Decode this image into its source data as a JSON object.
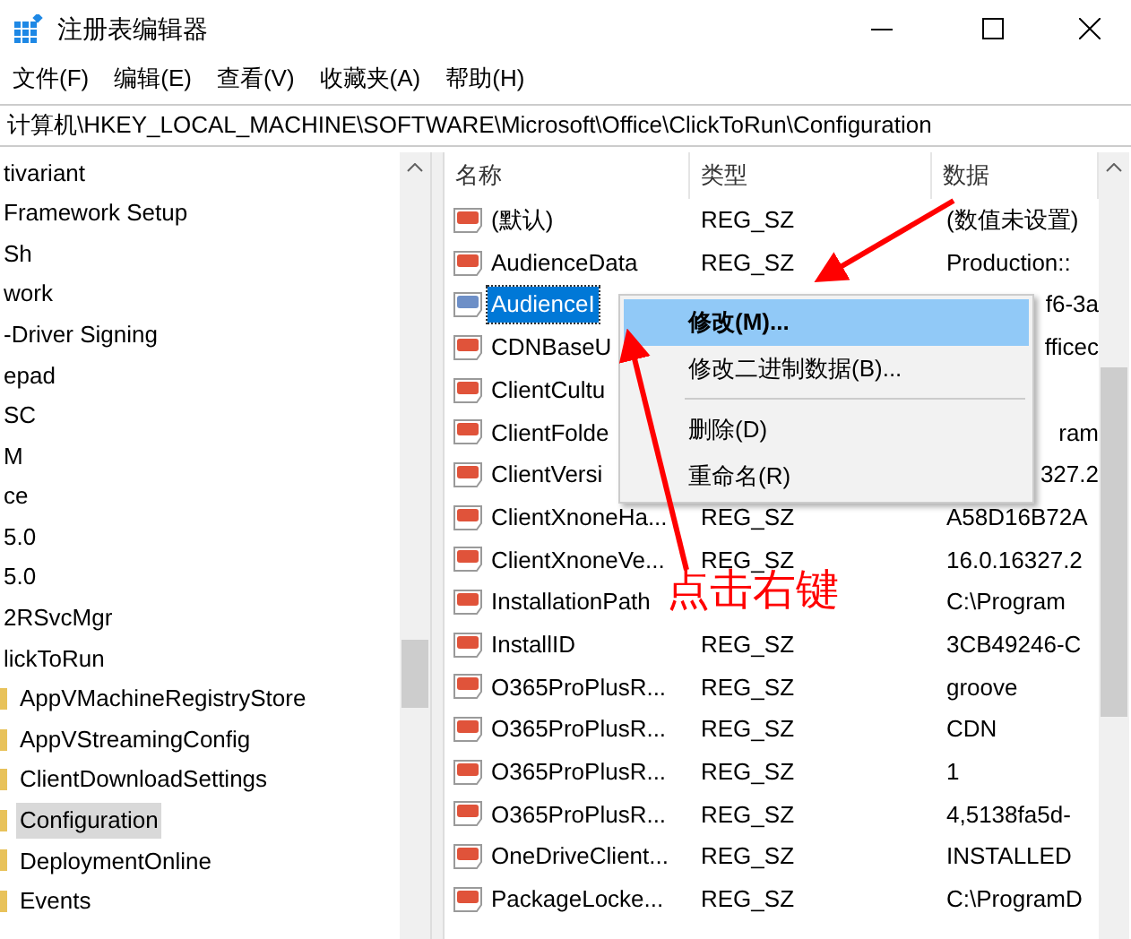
{
  "window": {
    "title": "注册表编辑器"
  },
  "menu_bar": [
    "文件(F)",
    "编辑(E)",
    "查看(V)",
    "收藏夹(A)",
    "帮助(H)"
  ],
  "address": "计算机\\HKEY_LOCAL_MACHINE\\SOFTWARE\\Microsoft\\Office\\ClickToRun\\Configuration",
  "tree": [
    {
      "label": "tivariant",
      "selected": false
    },
    {
      "label": "Framework Setup",
      "selected": false
    },
    {
      "label": "Sh",
      "selected": false
    },
    {
      "label": "work",
      "selected": false
    },
    {
      "label": "-Driver Signing",
      "selected": false
    },
    {
      "label": "epad",
      "selected": false
    },
    {
      "label": "SC",
      "selected": false
    },
    {
      "label": "M",
      "selected": false
    },
    {
      "label": "ce",
      "selected": false
    },
    {
      "label": "5.0",
      "selected": false
    },
    {
      "label": "5.0",
      "selected": false
    },
    {
      "label": "2RSvcMgr",
      "selected": false
    },
    {
      "label": "lickToRun",
      "selected": false,
      "children": [
        {
          "label": "AppVMachineRegistryStore",
          "selected": false
        },
        {
          "label": "AppVStreamingConfig",
          "selected": false
        },
        {
          "label": "ClientDownloadSettings",
          "selected": false
        },
        {
          "label": "Configuration",
          "selected": true
        },
        {
          "label": "DeploymentOnline",
          "selected": false
        },
        {
          "label": "Events",
          "selected": false
        }
      ]
    }
  ],
  "values": {
    "columns": [
      "名称",
      "类型",
      "数据"
    ],
    "rows": [
      {
        "name": "(默认)",
        "type": "REG_SZ",
        "data": "(数值未设置)",
        "selected": false,
        "covered": false
      },
      {
        "name": "AudienceData",
        "type": "REG_SZ",
        "data": "Production::",
        "selected": false,
        "covered": false
      },
      {
        "name": "AudienceI",
        "data": "f6-3a",
        "selected": true,
        "covered": true
      },
      {
        "name": "CDNBaseU",
        "data": "fficec",
        "selected": false,
        "covered": true
      },
      {
        "name": "ClientCultu",
        "selected": false
      },
      {
        "name": "ClientFolde",
        "data": "ram",
        "selected": false,
        "covered": true
      },
      {
        "name": "ClientVersi",
        "data": "327.2",
        "selected": false,
        "covered": true
      },
      {
        "name": "ClientXnoneHa...",
        "type": "REG_SZ",
        "data": "A58D16B72A",
        "selected": false,
        "covered": false
      },
      {
        "name": "ClientXnoneVe...",
        "type": "REG_SZ",
        "data": "16.0.16327.2",
        "selected": false,
        "covered": false
      },
      {
        "name": "InstallationPath",
        "data": "C:\\Program",
        "selected": false,
        "covered": false
      },
      {
        "name": "InstallID",
        "type": "REG_SZ",
        "data": "3CB49246-C",
        "selected": false,
        "covered": false
      },
      {
        "name": "O365ProPlusR...",
        "type": "REG_SZ",
        "data": "groove",
        "selected": false,
        "covered": false
      },
      {
        "name": "O365ProPlusR...",
        "type": "REG_SZ",
        "data": "CDN",
        "selected": false,
        "covered": false
      },
      {
        "name": "O365ProPlusR...",
        "type": "REG_SZ",
        "data": "1",
        "selected": false,
        "covered": false
      },
      {
        "name": "O365ProPlusR...",
        "type": "REG_SZ",
        "data": "4,5138fa5d-",
        "selected": false,
        "covered": false
      },
      {
        "name": "OneDriveClient...",
        "type": "REG_SZ",
        "data": "INSTALLED",
        "selected": false,
        "covered": false
      },
      {
        "name": "PackageLocke...",
        "type": "REG_SZ",
        "data": "C:\\ProgramD",
        "selected": false,
        "covered": false
      }
    ]
  },
  "context_menu": [
    {
      "kind": "item",
      "label": "修改(M)...",
      "selected": true,
      "default": true
    },
    {
      "kind": "item",
      "label": "修改二进制数据(B)...",
      "selected": false,
      "default": false
    },
    {
      "kind": "separator"
    },
    {
      "kind": "item",
      "label": "删除(D)",
      "selected": false,
      "default": false
    },
    {
      "kind": "item",
      "label": "重命名(R)",
      "selected": false,
      "default": false
    }
  ],
  "annotation": {
    "text": "点击右键"
  }
}
